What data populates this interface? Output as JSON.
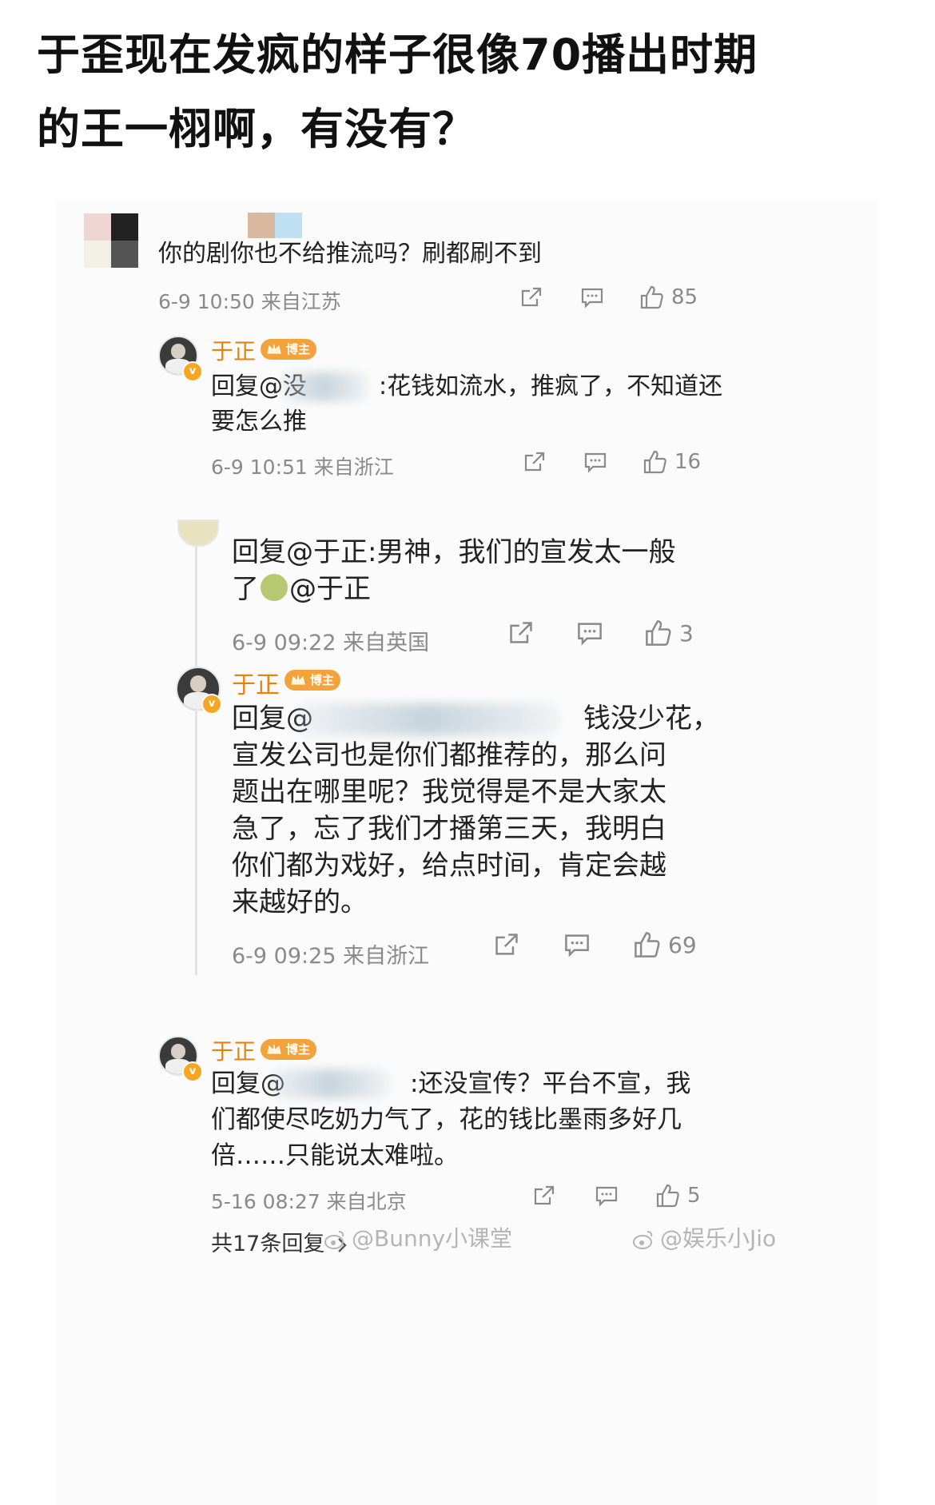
{
  "headline": {
    "line1": "于歪现在发疯的样子很像70播出时期",
    "line2": "的王一栩啊，有没有？"
  },
  "comments": [
    {
      "text": "你的剧你也不给推流吗？刷都刷不到",
      "meta": "6-9 10:50  来自江苏",
      "likes": "85"
    },
    {
      "name": "于正",
      "badge": "博主",
      "text_line1_prefix": "回复@没",
      "text_line1_suffix": ":花钱如流水，推疯了，不知道还",
      "text_line2": "要怎么推",
      "meta": "6-9 10:51  来自浙江",
      "likes": "16"
    },
    {
      "text_line1": "回复@于正:男神，我们的宣发太一般",
      "text_line2_prefix": "了",
      "text_line2_suffix": "@于正",
      "meta": "6-9 09:22  来自英国",
      "likes": "3"
    },
    {
      "name": "于正",
      "badge": "博主",
      "text_line1_prefix": "回复@",
      "text_line1_suffix": "钱没少花，",
      "text_lines": [
        "宣发公司也是你们都推荐的，那么问",
        "题出在哪里呢？我觉得是不是大家太",
        "急了，忘了我们才播第三天，我明白",
        "你们都为戏好，给点时间，肯定会越",
        "来越好的。"
      ],
      "meta": "6-9 09:25  来自浙江",
      "likes": "69"
    },
    {
      "name": "于正",
      "badge": "博主",
      "text_line1_prefix": "回复@",
      "text_line1_suffix": ":还没宣传？平台不宣，我",
      "text_lines": [
        "们都使尽吃奶力气了，花的钱比墨雨多好几",
        "倍……只能说太难啦。"
      ],
      "meta": "5-16 08:27  来自北京",
      "likes": "5"
    }
  ],
  "footer": {
    "replies_link": "共17条回复",
    "watermark1": "@Bunny小课堂",
    "watermark2": "@娱乐小Jio"
  },
  "colors": {
    "name_orange": "#e8820c",
    "badge_orange": "#f3a23c",
    "meta_gray": "#8a8a8a"
  },
  "icons": [
    "share-icon",
    "comment-icon",
    "like-icon",
    "chevron-right-icon",
    "weibo-icon"
  ]
}
